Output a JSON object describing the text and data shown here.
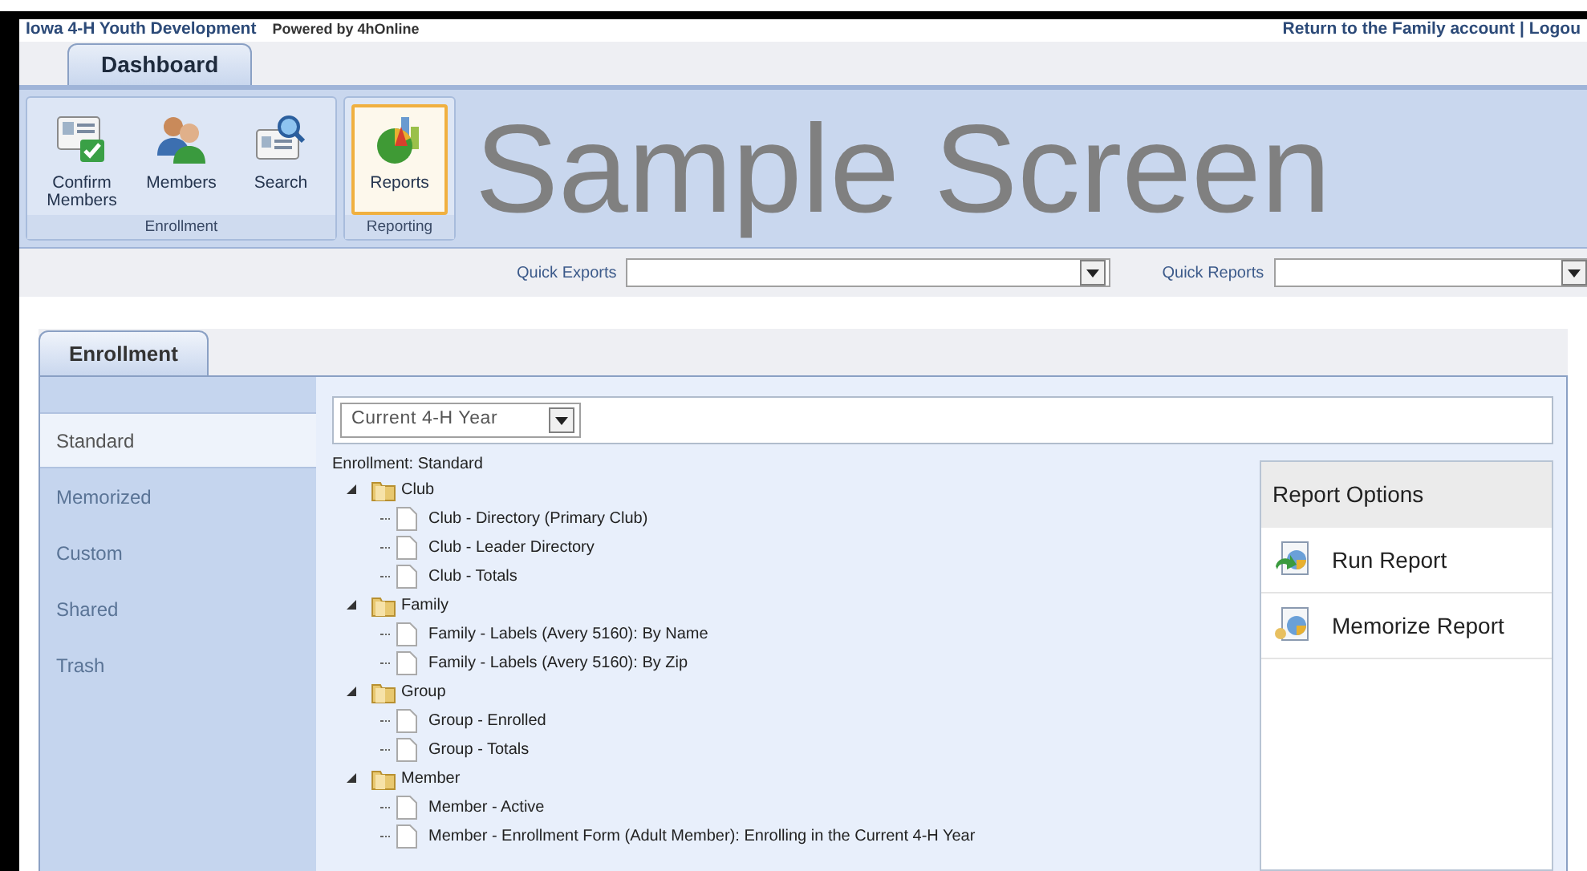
{
  "header": {
    "org": "Iowa 4-H Youth Development",
    "powered_by": "Powered by 4hOnline",
    "links": [
      "Return to the Family account",
      "Logou"
    ],
    "separator": "|"
  },
  "top_tabs": [
    {
      "label": "Dashboard",
      "selected": true
    }
  ],
  "ribbon": {
    "groups": [
      {
        "label": "Enrollment",
        "buttons": [
          {
            "label": "Confirm Members",
            "kind": "confirm",
            "selected": false
          },
          {
            "label": "Members",
            "kind": "members",
            "selected": false
          },
          {
            "label": "Search",
            "kind": "search",
            "selected": false
          }
        ]
      },
      {
        "label": "Reporting",
        "buttons": [
          {
            "label": "Reports",
            "kind": "reports",
            "selected": true
          }
        ]
      }
    ]
  },
  "overlay_caption": "Sample Screen",
  "quick_bar": {
    "exports_label": "Quick Exports",
    "reports_label": "Quick Reports"
  },
  "section_tabs": [
    {
      "label": "Enrollment",
      "selected": true
    }
  ],
  "sidebar": {
    "items": [
      {
        "label": "Standard",
        "selected": true
      },
      {
        "label": "Memorized",
        "selected": false
      },
      {
        "label": "Custom",
        "selected": false
      },
      {
        "label": "Shared",
        "selected": false
      },
      {
        "label": "Trash",
        "selected": false
      }
    ]
  },
  "year_select": {
    "value": "Current 4-H Year"
  },
  "tree": {
    "title": "Enrollment: Standard",
    "folders": [
      {
        "label": "Club",
        "expanded": true,
        "children": [
          {
            "label": "Club - Directory (Primary Club)"
          },
          {
            "label": "Club - Leader Directory"
          },
          {
            "label": "Club - Totals"
          }
        ]
      },
      {
        "label": "Family",
        "expanded": true,
        "children": [
          {
            "label": "Family - Labels (Avery 5160): By Name"
          },
          {
            "label": "Family - Labels (Avery 5160): By Zip"
          }
        ]
      },
      {
        "label": "Group",
        "expanded": true,
        "children": [
          {
            "label": "Group - Enrolled"
          },
          {
            "label": "Group - Totals"
          }
        ]
      },
      {
        "label": "Member",
        "expanded": true,
        "children": [
          {
            "label": "Member - Active"
          },
          {
            "label": "Member - Enrollment Form (Adult Member): Enrolling in the Current 4-H Year"
          }
        ]
      }
    ]
  },
  "report_options": {
    "title": "Report Options",
    "actions": [
      {
        "label": "Run Report",
        "kind": "run"
      },
      {
        "label": "Memorize Report",
        "kind": "memorize"
      }
    ]
  }
}
